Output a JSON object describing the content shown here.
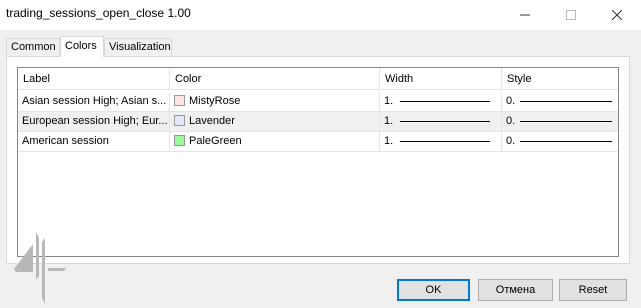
{
  "window": {
    "title": "trading_sessions_open_close 1.00",
    "controls": {
      "minimize": "minimize-icon",
      "maximize": "maximize-icon",
      "close": "close-icon"
    }
  },
  "tabs": [
    {
      "label": "Common",
      "active": false
    },
    {
      "label": "Colors",
      "active": true
    },
    {
      "label": "Visualization",
      "active": false
    }
  ],
  "grid": {
    "headers": {
      "label": "Label",
      "color": "Color",
      "width": "Width",
      "style": "Style"
    },
    "rows": [
      {
        "label": "Asian session High; Asian s...",
        "color_name": "MistyRose",
        "swatch": "#FFE4E1",
        "width": "1.",
        "style": "0."
      },
      {
        "label": "European session High; Eur...",
        "color_name": "Lavender",
        "swatch": "#E6E6FA",
        "width": "1.",
        "style": "0."
      },
      {
        "label": "American session",
        "color_name": "PaleGreen",
        "swatch": "#98FB98",
        "width": "1.",
        "style": "0."
      }
    ]
  },
  "buttons": {
    "ok": "OK",
    "cancel": "Отмена",
    "reset": "Reset"
  },
  "colors": {
    "accent": "#0078d7",
    "selected_row": "#f0f0f0"
  }
}
